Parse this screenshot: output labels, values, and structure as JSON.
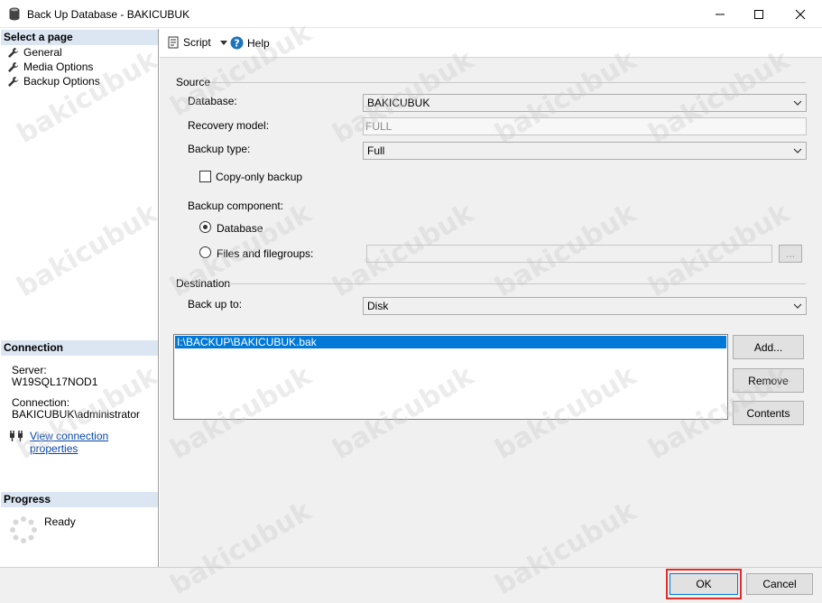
{
  "window": {
    "title": "Back Up Database - BAKICUBUK",
    "minimize_icon": "minimize-icon",
    "maximize_icon": "maximize-icon",
    "close_icon": "close-icon"
  },
  "left_pane": {
    "select_page_header": "Select a page",
    "pages": [
      {
        "label": "General",
        "icon": "wrench-icon"
      },
      {
        "label": "Media Options",
        "icon": "wrench-icon"
      },
      {
        "label": "Backup Options",
        "icon": "wrench-icon"
      }
    ],
    "connection_header": "Connection",
    "server_label": "Server:",
    "server_value": "W19SQL17NOD1",
    "connection_label": "Connection:",
    "connection_value": "BAKICUBUK\\administrator",
    "view_connection_link": "View connection properties",
    "progress_header": "Progress",
    "progress_status": "Ready"
  },
  "toolbar": {
    "script_label": "Script",
    "help_label": "Help"
  },
  "source": {
    "group_label": "Source",
    "database_label": "Database:",
    "database_value": "BAKICUBUK",
    "recovery_model_label": "Recovery model:",
    "recovery_model_value": "FULL",
    "backup_type_label": "Backup type:",
    "backup_type_value": "Full",
    "copy_only_label": "Copy-only backup",
    "copy_only_checked": false,
    "backup_component_label": "Backup component:",
    "component_database_label": "Database",
    "component_files_label": "Files and filegroups:",
    "component_selected": "Database",
    "browse_button": "..."
  },
  "destination": {
    "group_label": "Destination",
    "back_up_to_label": "Back up to:",
    "back_up_to_value": "Disk",
    "files": [
      "I:\\BACKUP\\BAKICUBUK.bak"
    ],
    "add_button": "Add...",
    "remove_button": "Remove",
    "contents_button": "Contents"
  },
  "footer": {
    "ok_button": "OK",
    "cancel_button": "Cancel"
  },
  "watermark_text": "bakicubuk",
  "colors": {
    "selection": "#0078d7",
    "section_header": "#dbe6f2",
    "highlight_border": "#e32b2b"
  }
}
